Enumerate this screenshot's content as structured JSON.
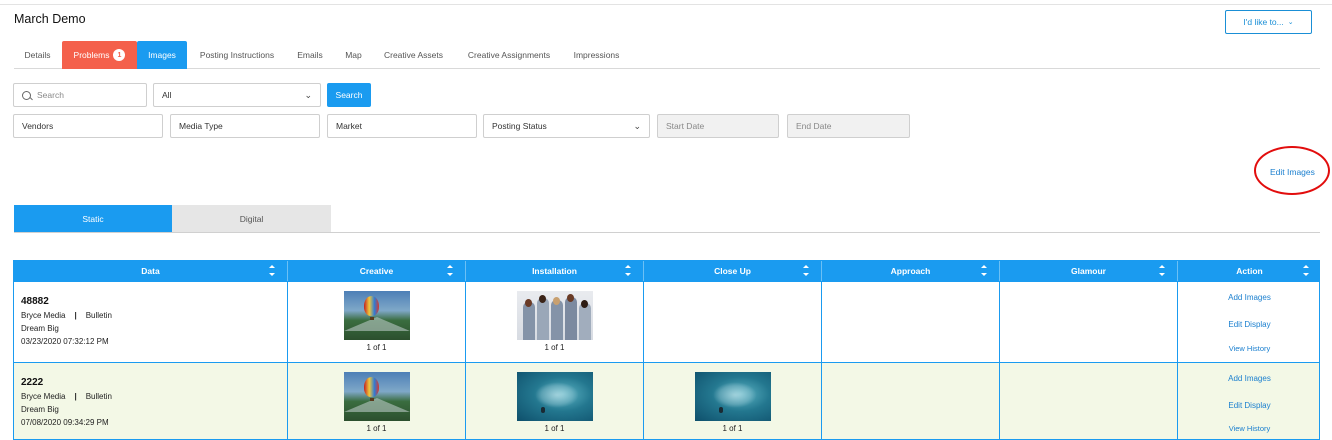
{
  "page": {
    "title": "March Demo"
  },
  "header": {
    "actions_label": "I'd like to...",
    "actions_chevron": "chevron-down-icon"
  },
  "tabs": [
    {
      "label": "Details"
    },
    {
      "label": "Problems",
      "badge": "1"
    },
    {
      "label": "Images",
      "active": true
    },
    {
      "label": "Posting Instructions"
    },
    {
      "label": "Emails"
    },
    {
      "label": "Map"
    },
    {
      "label": "Creative Assets"
    },
    {
      "label": "Creative Assignments"
    },
    {
      "label": "Impressions"
    }
  ],
  "filters": {
    "search_placeholder": "Search",
    "scope_value": "All",
    "search_button": "Search",
    "vendors": "Vendors",
    "media_type": "Media Type",
    "market": "Market",
    "posting_status": "Posting Status",
    "start_date_placeholder": "Start Date",
    "end_date_placeholder": "End Date"
  },
  "edit_images_label": "Edit Images",
  "view_modes": [
    {
      "label": "Static",
      "active": true
    },
    {
      "label": "Digital"
    }
  ],
  "grid": {
    "columns": [
      "Data",
      "Creative",
      "Installation",
      "Close Up",
      "Approach",
      "Glamour",
      "Action"
    ],
    "rows": [
      {
        "id": "48882",
        "vendor": "Bryce Media",
        "media": "Bulletin",
        "creative_name": "Dream Big",
        "timestamp": "03/23/2020 07:32:12 PM",
        "creative": {
          "image": "hot-air-balloon",
          "count": "1 of 1"
        },
        "installation": {
          "image": "bridesmaids-group",
          "count": "1 of 1"
        },
        "close_up": null,
        "actions": [
          "Add Images",
          "Edit Display",
          "View History"
        ]
      },
      {
        "id": "2222",
        "vendor": "Bryce Media",
        "media": "Bulletin",
        "creative_name": "Dream Big",
        "timestamp": "07/08/2020 09:34:29 PM",
        "creative": {
          "image": "hot-air-balloon",
          "count": "1 of 1"
        },
        "installation": {
          "image": "school-of-fish-diver",
          "count": "1 of 1"
        },
        "close_up": {
          "image": "school-of-fish-diver",
          "count": "1 of 1"
        },
        "actions": [
          "Add Images",
          "Edit Display",
          "View History"
        ]
      }
    ]
  },
  "colors": {
    "accent": "#1a9bf0",
    "problems": "#f4604b",
    "alt_row": "#f3f8e6",
    "highlight_oval": "#e20d0d"
  }
}
